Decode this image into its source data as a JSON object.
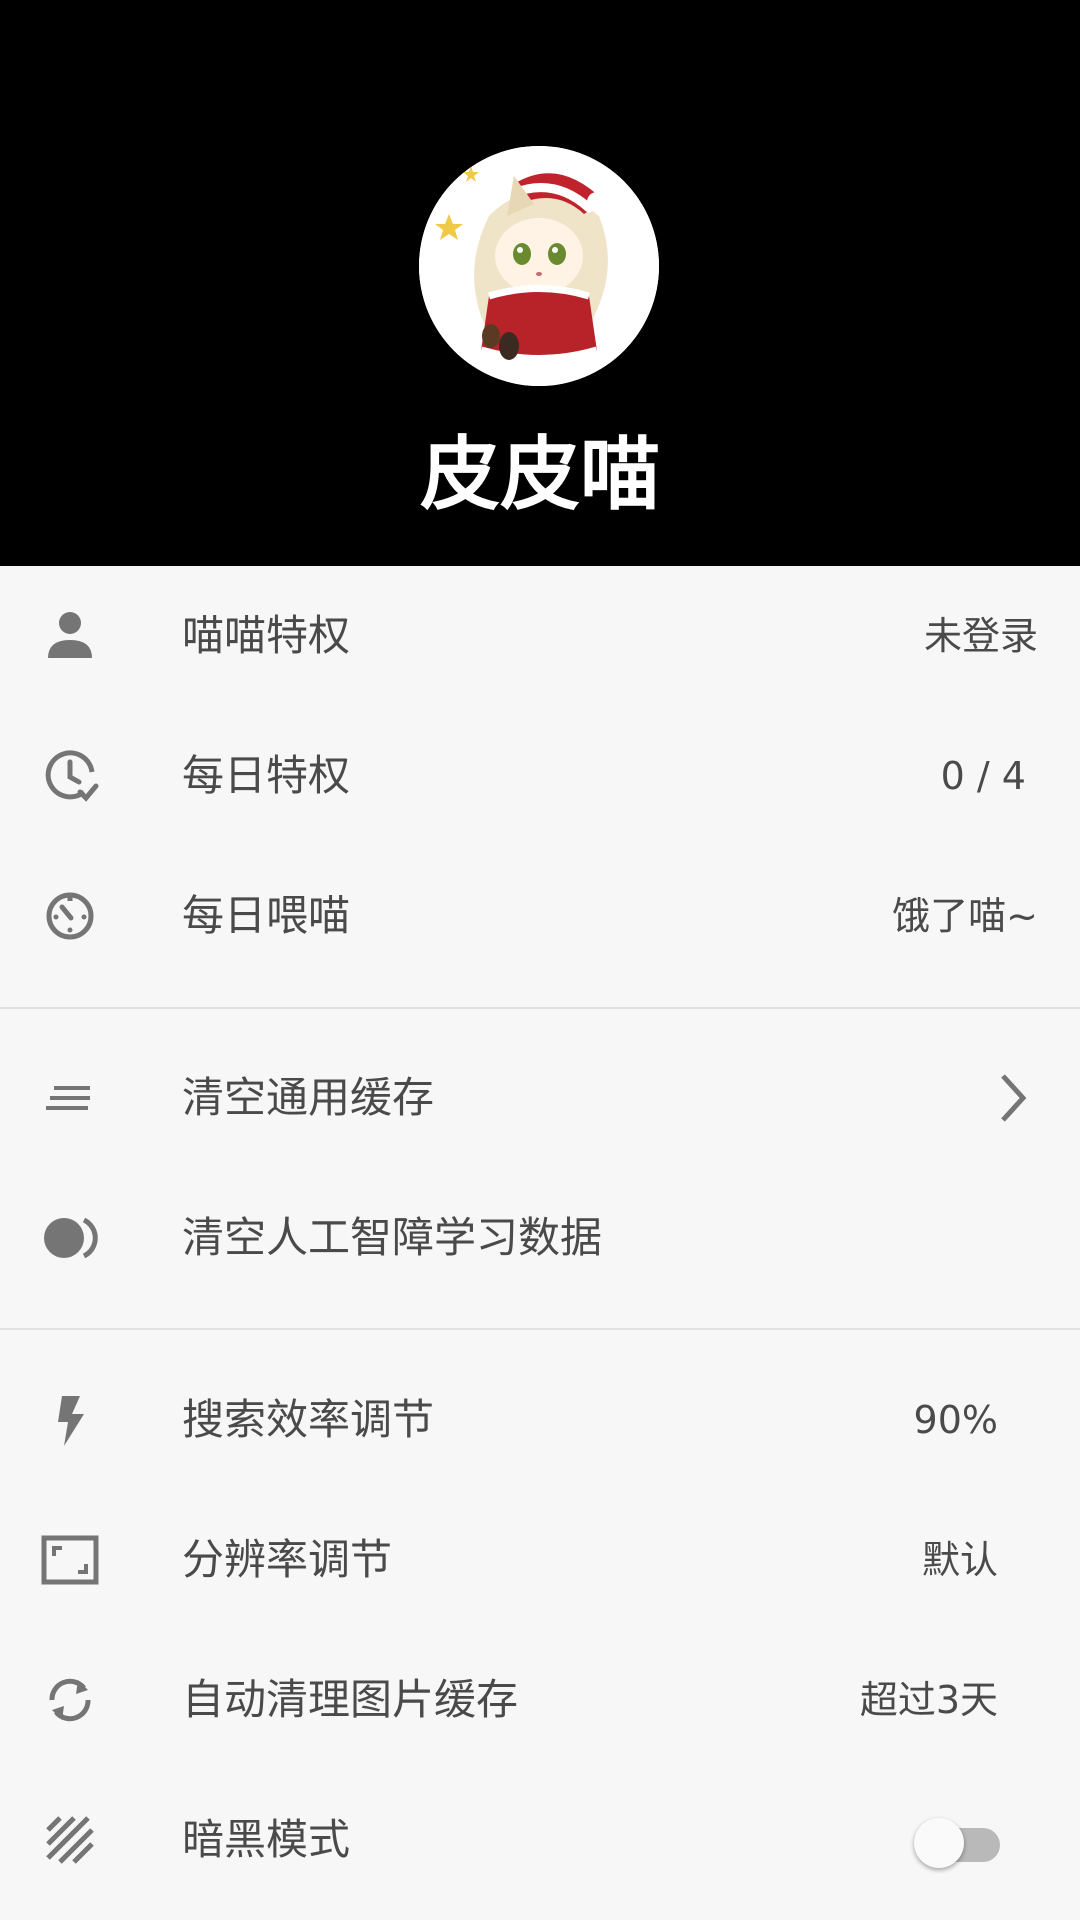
{
  "profile": {
    "username": "皮皮喵",
    "avatar_icon": "cat-girl-avatar"
  },
  "section1": [
    {
      "icon": "person-icon",
      "label": "喵喵特权",
      "value": "未登录"
    },
    {
      "icon": "clock-check-icon",
      "label": "每日特权",
      "value": "0 / 4"
    },
    {
      "icon": "timer-icon",
      "label": "每日喂喵",
      "value": "饿了喵~"
    }
  ],
  "section2": [
    {
      "icon": "lines-icon",
      "label": "清空通用缓存",
      "action_icon": "chevron-right-icon"
    },
    {
      "icon": "toggle-circle-icon",
      "label": "清空人工智障学习数据"
    }
  ],
  "section3": [
    {
      "icon": "flash-icon",
      "label": "搜索效率调节",
      "value": "90%"
    },
    {
      "icon": "aspect-ratio-icon",
      "label": "分辨率调节",
      "value": "默认"
    },
    {
      "icon": "sync-icon",
      "label": "自动清理图片缓存",
      "value": "超过3天"
    },
    {
      "icon": "stripes-icon",
      "label": "暗黑模式",
      "toggle_on": false
    }
  ],
  "colors": {
    "header_bg": "#000000",
    "page_bg": "#f7f7f7",
    "icon_gray": "#757575",
    "text": "#4a4a4a",
    "divider": "#e2e2e2"
  }
}
